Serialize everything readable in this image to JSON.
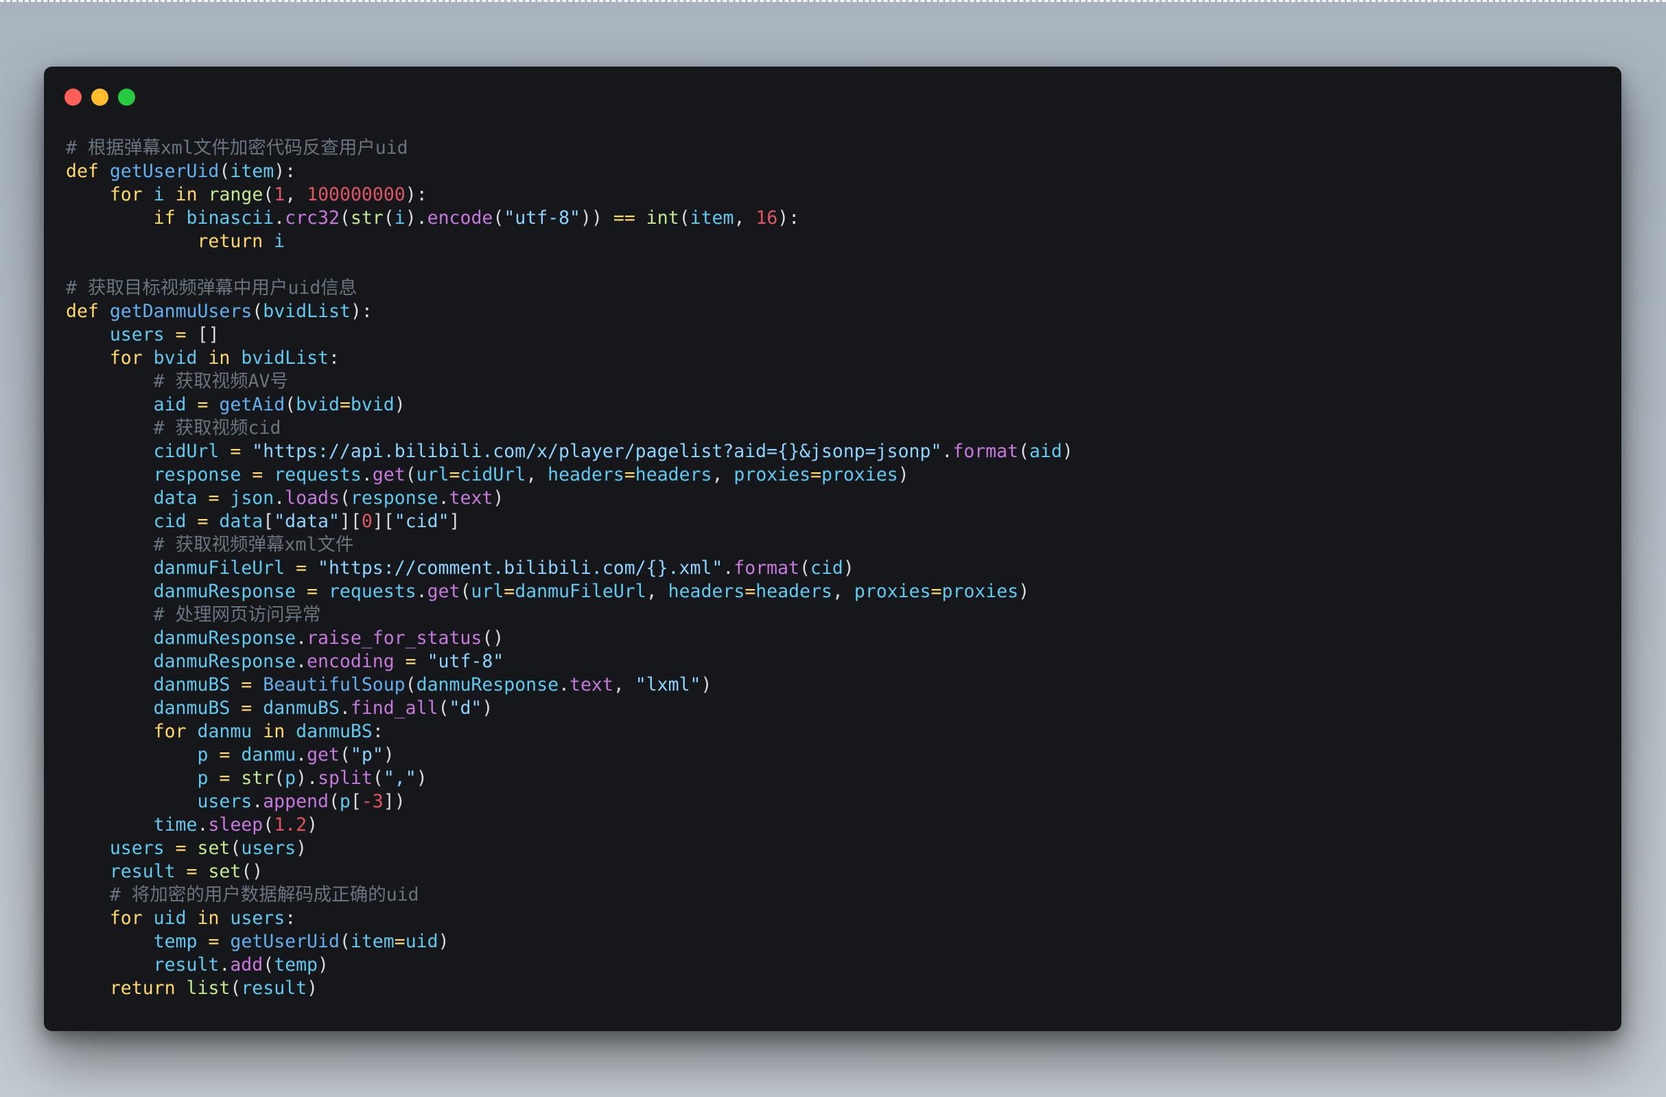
{
  "theme": {
    "colors": {
      "comment": "#6b737e",
      "keyword": "#ffd866",
      "func": "#61afef",
      "ident": "#5fc9f0",
      "punct": "#d7dae0",
      "number": "#e05561",
      "string": "#8bd4ff",
      "builtin": "#c3e88d",
      "attr": "#c678dd",
      "operator": "#ffd866",
      "text": "#d7dae0"
    }
  },
  "window": {
    "controls": [
      "close",
      "minimize",
      "maximize"
    ]
  },
  "code": {
    "language": "python",
    "lines": [
      [
        [
          "comment",
          "# 根据弹幕xml文件加密代码反查用户uid"
        ]
      ],
      [
        [
          "keyword",
          "def"
        ],
        [
          "text",
          " "
        ],
        [
          "func",
          "getUserUid"
        ],
        [
          "punct",
          "("
        ],
        [
          "ident",
          "item"
        ],
        [
          "punct",
          "):"
        ]
      ],
      [
        [
          "text",
          "    "
        ],
        [
          "keyword",
          "for"
        ],
        [
          "text",
          " "
        ],
        [
          "ident",
          "i"
        ],
        [
          "text",
          " "
        ],
        [
          "keyword",
          "in"
        ],
        [
          "text",
          " "
        ],
        [
          "builtin",
          "range"
        ],
        [
          "punct",
          "("
        ],
        [
          "number",
          "1"
        ],
        [
          "punct",
          ", "
        ],
        [
          "number",
          "100000000"
        ],
        [
          "punct",
          "):"
        ]
      ],
      [
        [
          "text",
          "        "
        ],
        [
          "keyword",
          "if"
        ],
        [
          "text",
          " "
        ],
        [
          "ident",
          "binascii"
        ],
        [
          "punct",
          "."
        ],
        [
          "attr",
          "crc32"
        ],
        [
          "punct",
          "("
        ],
        [
          "builtin",
          "str"
        ],
        [
          "punct",
          "("
        ],
        [
          "ident",
          "i"
        ],
        [
          "punct",
          ")."
        ],
        [
          "attr",
          "encode"
        ],
        [
          "punct",
          "("
        ],
        [
          "string",
          "\"utf-8\""
        ],
        [
          "punct",
          ")) "
        ],
        [
          "operator",
          "=="
        ],
        [
          "text",
          " "
        ],
        [
          "builtin",
          "int"
        ],
        [
          "punct",
          "("
        ],
        [
          "ident",
          "item"
        ],
        [
          "punct",
          ", "
        ],
        [
          "number",
          "16"
        ],
        [
          "punct",
          "):"
        ]
      ],
      [
        [
          "text",
          "            "
        ],
        [
          "keyword",
          "return"
        ],
        [
          "text",
          " "
        ],
        [
          "ident",
          "i"
        ]
      ],
      [],
      [
        [
          "comment",
          "# 获取目标视频弹幕中用户uid信息"
        ]
      ],
      [
        [
          "keyword",
          "def"
        ],
        [
          "text",
          " "
        ],
        [
          "func",
          "getDanmuUsers"
        ],
        [
          "punct",
          "("
        ],
        [
          "ident",
          "bvidList"
        ],
        [
          "punct",
          "):"
        ]
      ],
      [
        [
          "text",
          "    "
        ],
        [
          "ident",
          "users"
        ],
        [
          "text",
          " "
        ],
        [
          "operator",
          "="
        ],
        [
          "text",
          " "
        ],
        [
          "punct",
          "[]"
        ]
      ],
      [
        [
          "text",
          "    "
        ],
        [
          "keyword",
          "for"
        ],
        [
          "text",
          " "
        ],
        [
          "ident",
          "bvid"
        ],
        [
          "text",
          " "
        ],
        [
          "keyword",
          "in"
        ],
        [
          "text",
          " "
        ],
        [
          "ident",
          "bvidList"
        ],
        [
          "punct",
          ":"
        ]
      ],
      [
        [
          "text",
          "        "
        ],
        [
          "comment",
          "# 获取视频AV号"
        ]
      ],
      [
        [
          "text",
          "        "
        ],
        [
          "ident",
          "aid"
        ],
        [
          "text",
          " "
        ],
        [
          "operator",
          "="
        ],
        [
          "text",
          " "
        ],
        [
          "func",
          "getAid"
        ],
        [
          "punct",
          "("
        ],
        [
          "ident",
          "bvid"
        ],
        [
          "operator",
          "="
        ],
        [
          "ident",
          "bvid"
        ],
        [
          "punct",
          ")"
        ]
      ],
      [
        [
          "text",
          "        "
        ],
        [
          "comment",
          "# 获取视频cid"
        ]
      ],
      [
        [
          "text",
          "        "
        ],
        [
          "ident",
          "cidUrl"
        ],
        [
          "text",
          " "
        ],
        [
          "operator",
          "="
        ],
        [
          "text",
          " "
        ],
        [
          "string",
          "\"https://api.bilibili.com/x/player/pagelist?aid={}&jsonp=jsonp\""
        ],
        [
          "punct",
          "."
        ],
        [
          "attr",
          "format"
        ],
        [
          "punct",
          "("
        ],
        [
          "ident",
          "aid"
        ],
        [
          "punct",
          ")"
        ]
      ],
      [
        [
          "text",
          "        "
        ],
        [
          "ident",
          "response"
        ],
        [
          "text",
          " "
        ],
        [
          "operator",
          "="
        ],
        [
          "text",
          " "
        ],
        [
          "ident",
          "requests"
        ],
        [
          "punct",
          "."
        ],
        [
          "attr",
          "get"
        ],
        [
          "punct",
          "("
        ],
        [
          "ident",
          "url"
        ],
        [
          "operator",
          "="
        ],
        [
          "ident",
          "cidUrl"
        ],
        [
          "punct",
          ", "
        ],
        [
          "ident",
          "headers"
        ],
        [
          "operator",
          "="
        ],
        [
          "ident",
          "headers"
        ],
        [
          "punct",
          ", "
        ],
        [
          "ident",
          "proxies"
        ],
        [
          "operator",
          "="
        ],
        [
          "ident",
          "proxies"
        ],
        [
          "punct",
          ")"
        ]
      ],
      [
        [
          "text",
          "        "
        ],
        [
          "ident",
          "data"
        ],
        [
          "text",
          " "
        ],
        [
          "operator",
          "="
        ],
        [
          "text",
          " "
        ],
        [
          "ident",
          "json"
        ],
        [
          "punct",
          "."
        ],
        [
          "attr",
          "loads"
        ],
        [
          "punct",
          "("
        ],
        [
          "ident",
          "response"
        ],
        [
          "punct",
          "."
        ],
        [
          "attr",
          "text"
        ],
        [
          "punct",
          ")"
        ]
      ],
      [
        [
          "text",
          "        "
        ],
        [
          "ident",
          "cid"
        ],
        [
          "text",
          " "
        ],
        [
          "operator",
          "="
        ],
        [
          "text",
          " "
        ],
        [
          "ident",
          "data"
        ],
        [
          "punct",
          "["
        ],
        [
          "string",
          "\"data\""
        ],
        [
          "punct",
          "]["
        ],
        [
          "number",
          "0"
        ],
        [
          "punct",
          "]["
        ],
        [
          "string",
          "\"cid\""
        ],
        [
          "punct",
          "]"
        ]
      ],
      [
        [
          "text",
          "        "
        ],
        [
          "comment",
          "# 获取视频弹幕xml文件"
        ]
      ],
      [
        [
          "text",
          "        "
        ],
        [
          "ident",
          "danmuFileUrl"
        ],
        [
          "text",
          " "
        ],
        [
          "operator",
          "="
        ],
        [
          "text",
          " "
        ],
        [
          "string",
          "\"https://comment.bilibili.com/{}.xml\""
        ],
        [
          "punct",
          "."
        ],
        [
          "attr",
          "format"
        ],
        [
          "punct",
          "("
        ],
        [
          "ident",
          "cid"
        ],
        [
          "punct",
          ")"
        ]
      ],
      [
        [
          "text",
          "        "
        ],
        [
          "ident",
          "danmuResponse"
        ],
        [
          "text",
          " "
        ],
        [
          "operator",
          "="
        ],
        [
          "text",
          " "
        ],
        [
          "ident",
          "requests"
        ],
        [
          "punct",
          "."
        ],
        [
          "attr",
          "get"
        ],
        [
          "punct",
          "("
        ],
        [
          "ident",
          "url"
        ],
        [
          "operator",
          "="
        ],
        [
          "ident",
          "danmuFileUrl"
        ],
        [
          "punct",
          ", "
        ],
        [
          "ident",
          "headers"
        ],
        [
          "operator",
          "="
        ],
        [
          "ident",
          "headers"
        ],
        [
          "punct",
          ", "
        ],
        [
          "ident",
          "proxies"
        ],
        [
          "operator",
          "="
        ],
        [
          "ident",
          "proxies"
        ],
        [
          "punct",
          ")"
        ]
      ],
      [
        [
          "text",
          "        "
        ],
        [
          "comment",
          "# 处理网页访问异常"
        ]
      ],
      [
        [
          "text",
          "        "
        ],
        [
          "ident",
          "danmuResponse"
        ],
        [
          "punct",
          "."
        ],
        [
          "attr",
          "raise_for_status"
        ],
        [
          "punct",
          "()"
        ]
      ],
      [
        [
          "text",
          "        "
        ],
        [
          "ident",
          "danmuResponse"
        ],
        [
          "punct",
          "."
        ],
        [
          "attr",
          "encoding"
        ],
        [
          "text",
          " "
        ],
        [
          "operator",
          "="
        ],
        [
          "text",
          " "
        ],
        [
          "string",
          "\"utf-8\""
        ]
      ],
      [
        [
          "text",
          "        "
        ],
        [
          "ident",
          "danmuBS"
        ],
        [
          "text",
          " "
        ],
        [
          "operator",
          "="
        ],
        [
          "text",
          " "
        ],
        [
          "func",
          "BeautifulSoup"
        ],
        [
          "punct",
          "("
        ],
        [
          "ident",
          "danmuResponse"
        ],
        [
          "punct",
          "."
        ],
        [
          "attr",
          "text"
        ],
        [
          "punct",
          ", "
        ],
        [
          "string",
          "\"lxml\""
        ],
        [
          "punct",
          ")"
        ]
      ],
      [
        [
          "text",
          "        "
        ],
        [
          "ident",
          "danmuBS"
        ],
        [
          "text",
          " "
        ],
        [
          "operator",
          "="
        ],
        [
          "text",
          " "
        ],
        [
          "ident",
          "danmuBS"
        ],
        [
          "punct",
          "."
        ],
        [
          "attr",
          "find_all"
        ],
        [
          "punct",
          "("
        ],
        [
          "string",
          "\"d\""
        ],
        [
          "punct",
          ")"
        ]
      ],
      [
        [
          "text",
          "        "
        ],
        [
          "keyword",
          "for"
        ],
        [
          "text",
          " "
        ],
        [
          "ident",
          "danmu"
        ],
        [
          "text",
          " "
        ],
        [
          "keyword",
          "in"
        ],
        [
          "text",
          " "
        ],
        [
          "ident",
          "danmuBS"
        ],
        [
          "punct",
          ":"
        ]
      ],
      [
        [
          "text",
          "            "
        ],
        [
          "ident",
          "p"
        ],
        [
          "text",
          " "
        ],
        [
          "operator",
          "="
        ],
        [
          "text",
          " "
        ],
        [
          "ident",
          "danmu"
        ],
        [
          "punct",
          "."
        ],
        [
          "attr",
          "get"
        ],
        [
          "punct",
          "("
        ],
        [
          "string",
          "\"p\""
        ],
        [
          "punct",
          ")"
        ]
      ],
      [
        [
          "text",
          "            "
        ],
        [
          "ident",
          "p"
        ],
        [
          "text",
          " "
        ],
        [
          "operator",
          "="
        ],
        [
          "text",
          " "
        ],
        [
          "builtin",
          "str"
        ],
        [
          "punct",
          "("
        ],
        [
          "ident",
          "p"
        ],
        [
          "punct",
          ")."
        ],
        [
          "attr",
          "split"
        ],
        [
          "punct",
          "("
        ],
        [
          "string",
          "\",\""
        ],
        [
          "punct",
          ")"
        ]
      ],
      [
        [
          "text",
          "            "
        ],
        [
          "ident",
          "users"
        ],
        [
          "punct",
          "."
        ],
        [
          "attr",
          "append"
        ],
        [
          "punct",
          "("
        ],
        [
          "ident",
          "p"
        ],
        [
          "punct",
          "["
        ],
        [
          "number",
          "-3"
        ],
        [
          "punct",
          "])"
        ]
      ],
      [
        [
          "text",
          "        "
        ],
        [
          "ident",
          "time"
        ],
        [
          "punct",
          "."
        ],
        [
          "attr",
          "sleep"
        ],
        [
          "punct",
          "("
        ],
        [
          "number",
          "1.2"
        ],
        [
          "punct",
          ")"
        ]
      ],
      [
        [
          "text",
          "    "
        ],
        [
          "ident",
          "users"
        ],
        [
          "text",
          " "
        ],
        [
          "operator",
          "="
        ],
        [
          "text",
          " "
        ],
        [
          "builtin",
          "set"
        ],
        [
          "punct",
          "("
        ],
        [
          "ident",
          "users"
        ],
        [
          "punct",
          ")"
        ]
      ],
      [
        [
          "text",
          "    "
        ],
        [
          "ident",
          "result"
        ],
        [
          "text",
          " "
        ],
        [
          "operator",
          "="
        ],
        [
          "text",
          " "
        ],
        [
          "builtin",
          "set"
        ],
        [
          "punct",
          "()"
        ]
      ],
      [
        [
          "text",
          "    "
        ],
        [
          "comment",
          "# 将加密的用户数据解码成正确的uid"
        ]
      ],
      [
        [
          "text",
          "    "
        ],
        [
          "keyword",
          "for"
        ],
        [
          "text",
          " "
        ],
        [
          "ident",
          "uid"
        ],
        [
          "text",
          " "
        ],
        [
          "keyword",
          "in"
        ],
        [
          "text",
          " "
        ],
        [
          "ident",
          "users"
        ],
        [
          "punct",
          ":"
        ]
      ],
      [
        [
          "text",
          "        "
        ],
        [
          "ident",
          "temp"
        ],
        [
          "text",
          " "
        ],
        [
          "operator",
          "="
        ],
        [
          "text",
          " "
        ],
        [
          "func",
          "getUserUid"
        ],
        [
          "punct",
          "("
        ],
        [
          "ident",
          "item"
        ],
        [
          "operator",
          "="
        ],
        [
          "ident",
          "uid"
        ],
        [
          "punct",
          ")"
        ]
      ],
      [
        [
          "text",
          "        "
        ],
        [
          "ident",
          "result"
        ],
        [
          "punct",
          "."
        ],
        [
          "attr",
          "add"
        ],
        [
          "punct",
          "("
        ],
        [
          "ident",
          "temp"
        ],
        [
          "punct",
          ")"
        ]
      ],
      [
        [
          "text",
          "    "
        ],
        [
          "keyword",
          "return"
        ],
        [
          "text",
          " "
        ],
        [
          "builtin",
          "list"
        ],
        [
          "punct",
          "("
        ],
        [
          "ident",
          "result"
        ],
        [
          "punct",
          ")"
        ]
      ]
    ]
  }
}
